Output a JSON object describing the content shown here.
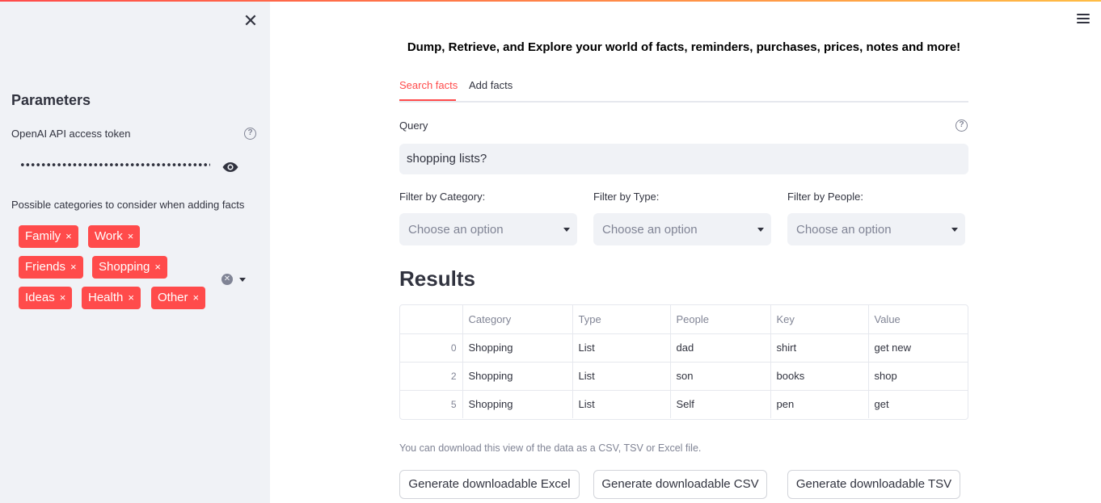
{
  "sidebar": {
    "close_icon": "close-icon",
    "title": "Parameters",
    "api_token": {
      "label": "OpenAI API access token",
      "value": "••••••••••••••••••••••••••••••••••••••••••••••••",
      "help_icon": "help-circle-icon",
      "toggle_icon": "eye-icon"
    },
    "categories": {
      "label": "Possible categories to consider when adding facts",
      "selected": [
        "Family",
        "Work",
        "Friends",
        "Shopping",
        "Ideas",
        "Health",
        "Other"
      ],
      "remove_glyph": "×"
    }
  },
  "header": {
    "menu_icon": "hamburger-menu-icon",
    "headline": "Dump, Retrieve, and Explore your world of facts, reminders, purchases, prices, notes and more!"
  },
  "tabs": [
    {
      "label": "Search facts",
      "active": true
    },
    {
      "label": "Add facts",
      "active": false
    }
  ],
  "query": {
    "label": "Query",
    "value": "shopping lists?",
    "help_icon": "help-circle-icon"
  },
  "filters": [
    {
      "label": "Filter by Category:",
      "placeholder": "Choose an option"
    },
    {
      "label": "Filter by Type:",
      "placeholder": "Choose an option"
    },
    {
      "label": "Filter by People:",
      "placeholder": "Choose an option"
    }
  ],
  "results": {
    "title": "Results",
    "columns": [
      "",
      "Category",
      "Type",
      "People",
      "Key",
      "Value"
    ],
    "rows": [
      [
        "0",
        "Shopping",
        "List",
        "dad",
        "shirt",
        "get new"
      ],
      [
        "2",
        "Shopping",
        "List",
        "son",
        "books",
        "shop"
      ],
      [
        "5",
        "Shopping",
        "List",
        "Self",
        "pen",
        "get"
      ]
    ]
  },
  "download": {
    "note": "You can download this view of the data as a CSV, TSV or Excel file.",
    "buttons": [
      "Generate downloadable Excel",
      "Generate downloadable CSV",
      "Generate downloadable TSV"
    ]
  },
  "colors": {
    "accent": "#ff4b4b",
    "sidebar_bg": "#f0f2f6",
    "text": "#31333f",
    "muted": "#808495"
  }
}
